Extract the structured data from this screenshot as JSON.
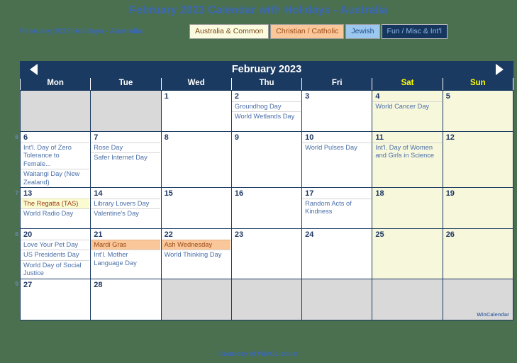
{
  "title": "February 2023 Calendar with Holidays - Australia",
  "legend": {
    "label": "February 2023 Holidays - Australia:",
    "buttons": [
      {
        "label": "Australia & Common",
        "key": "common"
      },
      {
        "label": "Christian / Catholic",
        "key": "christian"
      },
      {
        "label": "Jewish",
        "key": "jewish"
      },
      {
        "label": "Fun / Misc & Int'l",
        "key": "fun"
      }
    ]
  },
  "calendar": {
    "month_title": "February 2023",
    "prev_icon": "left-triangle-icon",
    "next_icon": "right-triangle-icon",
    "weekdays": [
      {
        "label": "Mon",
        "weekend": false
      },
      {
        "label": "Tue",
        "weekend": false
      },
      {
        "label": "Wed",
        "weekend": false
      },
      {
        "label": "Thu",
        "weekend": false
      },
      {
        "label": "Fri",
        "weekend": false
      },
      {
        "label": "Sat",
        "weekend": true
      },
      {
        "label": "Sun",
        "weekend": true
      }
    ],
    "week_numbers": [
      "",
      "6",
      "7",
      "8",
      "9"
    ],
    "weeks": [
      {
        "number": "",
        "days": [
          {
            "num": "",
            "blank": true,
            "weekend": false,
            "events": []
          },
          {
            "num": "",
            "blank": true,
            "weekend": false,
            "events": []
          },
          {
            "num": "1",
            "blank": false,
            "weekend": false,
            "events": []
          },
          {
            "num": "2",
            "blank": false,
            "weekend": false,
            "events": [
              {
                "text": "Groundhog Day",
                "type": "plain"
              },
              {
                "text": "World Wetlands Day",
                "type": "plain"
              }
            ]
          },
          {
            "num": "3",
            "blank": false,
            "weekend": false,
            "events": []
          },
          {
            "num": "4",
            "blank": false,
            "weekend": true,
            "events": [
              {
                "text": "World Cancer Day",
                "type": "plain"
              }
            ]
          },
          {
            "num": "5",
            "blank": false,
            "weekend": true,
            "events": []
          }
        ]
      },
      {
        "number": "6",
        "days": [
          {
            "num": "6",
            "blank": false,
            "weekend": false,
            "events": [
              {
                "text": "Int'l. Day of Zero Tolerance to Female...",
                "type": "plain"
              },
              {
                "text": "Waitangi Day (New Zealand)",
                "type": "plain"
              }
            ]
          },
          {
            "num": "7",
            "blank": false,
            "weekend": false,
            "events": [
              {
                "text": "Rose Day",
                "type": "plain"
              },
              {
                "text": "Safer Internet Day",
                "type": "plain"
              }
            ]
          },
          {
            "num": "8",
            "blank": false,
            "weekend": false,
            "events": []
          },
          {
            "num": "9",
            "blank": false,
            "weekend": false,
            "events": []
          },
          {
            "num": "10",
            "blank": false,
            "weekend": false,
            "events": [
              {
                "text": "World Pulses Day",
                "type": "plain"
              }
            ]
          },
          {
            "num": "11",
            "blank": false,
            "weekend": true,
            "events": [
              {
                "text": "Int'l. Day of Women and Girls in Science",
                "type": "plain"
              }
            ]
          },
          {
            "num": "12",
            "blank": false,
            "weekend": true,
            "events": []
          }
        ]
      },
      {
        "number": "7",
        "days": [
          {
            "num": "13",
            "blank": false,
            "weekend": false,
            "events": [
              {
                "text": "The Regatta (TAS)",
                "type": "common"
              },
              {
                "text": "World Radio Day",
                "type": "plain"
              }
            ]
          },
          {
            "num": "14",
            "blank": false,
            "weekend": false,
            "events": [
              {
                "text": "Library Lovers Day",
                "type": "plain"
              },
              {
                "text": "Valentine's Day",
                "type": "plain"
              }
            ]
          },
          {
            "num": "15",
            "blank": false,
            "weekend": false,
            "events": []
          },
          {
            "num": "16",
            "blank": false,
            "weekend": false,
            "events": []
          },
          {
            "num": "17",
            "blank": false,
            "weekend": false,
            "events": [
              {
                "text": "Random Acts of Kindness",
                "type": "plain"
              }
            ]
          },
          {
            "num": "18",
            "blank": false,
            "weekend": true,
            "events": []
          },
          {
            "num": "19",
            "blank": false,
            "weekend": true,
            "events": []
          }
        ]
      },
      {
        "number": "8",
        "days": [
          {
            "num": "20",
            "blank": false,
            "weekend": false,
            "events": [
              {
                "text": "Love Your Pet Day",
                "type": "plain"
              },
              {
                "text": "US Presidents Day",
                "type": "plain"
              },
              {
                "text": "World Day of Social Justice",
                "type": "plain"
              }
            ]
          },
          {
            "num": "21",
            "blank": false,
            "weekend": false,
            "events": [
              {
                "text": "Mardi Gras",
                "type": "christian"
              },
              {
                "text": "Int'l. Mother Language Day",
                "type": "plain"
              }
            ]
          },
          {
            "num": "22",
            "blank": false,
            "weekend": false,
            "events": [
              {
                "text": "Ash Wednesday",
                "type": "christian"
              },
              {
                "text": "World Thinking Day",
                "type": "plain"
              }
            ]
          },
          {
            "num": "23",
            "blank": false,
            "weekend": false,
            "events": []
          },
          {
            "num": "24",
            "blank": false,
            "weekend": false,
            "events": []
          },
          {
            "num": "25",
            "blank": false,
            "weekend": true,
            "events": []
          },
          {
            "num": "26",
            "blank": false,
            "weekend": true,
            "events": []
          }
        ]
      },
      {
        "number": "9",
        "days": [
          {
            "num": "27",
            "blank": false,
            "weekend": false,
            "events": []
          },
          {
            "num": "28",
            "blank": false,
            "weekend": false,
            "events": []
          },
          {
            "num": "",
            "blank": true,
            "weekend": false,
            "events": []
          },
          {
            "num": "",
            "blank": true,
            "weekend": false,
            "events": []
          },
          {
            "num": "",
            "blank": true,
            "weekend": false,
            "events": []
          },
          {
            "num": "",
            "blank": true,
            "weekend": false,
            "events": []
          },
          {
            "num": "",
            "blank": true,
            "weekend": false,
            "events": []
          }
        ]
      }
    ]
  },
  "watermark": "WinCalendar",
  "footer": {
    "prefix": "Courtesy of ",
    "brand": "WinCalendar"
  },
  "colors": {
    "page_bg": "#4a7050",
    "header_navy": "#1b3a61",
    "link_blue": "#3b68b5",
    "weekend_bg": "#f7f7dc",
    "blank_bg": "#d9d9d9",
    "common_hl": "#fbfbd2",
    "christian_hl": "#fac79b",
    "jewish_hl": "#9cc8f0"
  }
}
